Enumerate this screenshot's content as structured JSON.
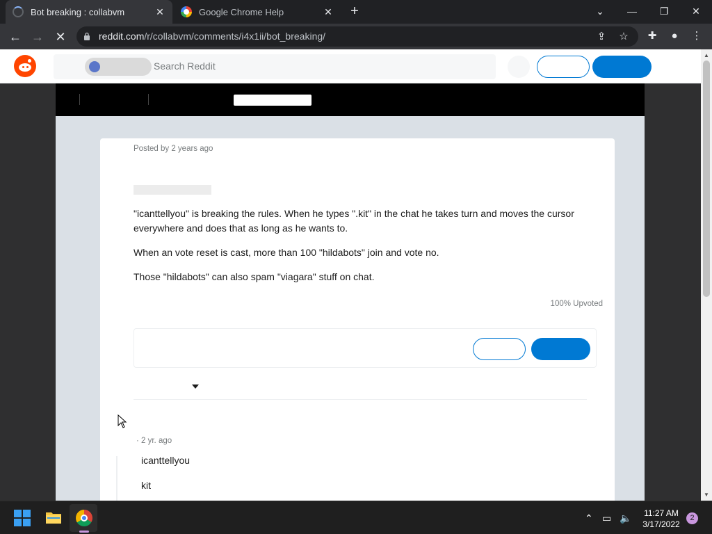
{
  "browser": {
    "tabs": [
      {
        "title": "Bot breaking : collabvm",
        "state": "loading"
      },
      {
        "title": "Google Chrome Help",
        "state": "idle"
      }
    ],
    "url_host": "reddit.com",
    "url_path": "/r/collabvm/comments/i4x1ii/bot_breaking/"
  },
  "reddit": {
    "search_placeholder": "Search Reddit"
  },
  "post": {
    "meta": "Posted by 2 years ago",
    "paragraphs": [
      "\"icanttellyou\" is breaking the rules. When he types \".kit\" in the chat he takes turn and moves the cursor everywhere and does that as long as he wants to.",
      "When an vote reset is cast, more than 100 \"hildabots\" join and vote no.",
      "Those \"hildabots\" can also spam \"viagara\" stuff on chat."
    ],
    "upvoted": "100% Upvoted"
  },
  "comment": {
    "meta": "· 2 yr. ago",
    "lines": [
      "icanttellyou",
      "kit"
    ]
  },
  "taskbar": {
    "time": "11:27 AM",
    "date": "3/17/2022",
    "notifications": "2"
  },
  "colors": {
    "reddit_orange": "#ff4500",
    "reddit_blue": "#0079d3",
    "chrome_dark": "#202124"
  }
}
